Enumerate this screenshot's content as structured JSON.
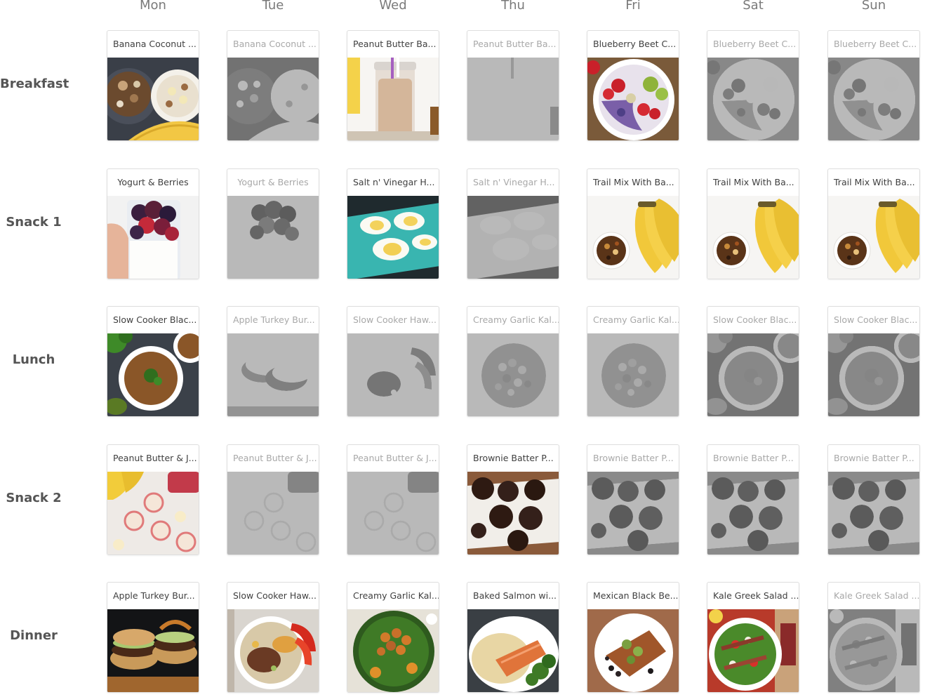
{
  "days": [
    "Mon",
    "Tue",
    "Wed",
    "Thu",
    "Fri",
    "Sat",
    "Sun"
  ],
  "meals": [
    {
      "label": "Breakfast",
      "items": [
        {
          "title": "Banana Coconut ...",
          "dim": false,
          "img": "oatmeal-bowl"
        },
        {
          "title": "Banana Coconut ...",
          "dim": true,
          "img": "oatmeal-bowl"
        },
        {
          "title": "Peanut Butter Ba...",
          "dim": false,
          "img": "smoothie-jar"
        },
        {
          "title": "Peanut Butter Ba...",
          "dim": true,
          "img": "smoothie-jar"
        },
        {
          "title": "Blueberry Beet C...",
          "dim": false,
          "img": "fruit-bowl"
        },
        {
          "title": "Blueberry Beet C...",
          "dim": true,
          "img": "fruit-bowl"
        },
        {
          "title": "Blueberry Beet C...",
          "dim": true,
          "img": "fruit-bowl"
        }
      ]
    },
    {
      "label": "Snack 1",
      "items": [
        {
          "title": "Yogurt & Berries",
          "dim": false,
          "img": "yogurt-cup"
        },
        {
          "title": "Yogurt & Berries",
          "dim": true,
          "img": "yogurt-cup"
        },
        {
          "title": "Salt n' Vinegar H...",
          "dim": false,
          "img": "eggs-plate"
        },
        {
          "title": "Salt n' Vinegar H...",
          "dim": true,
          "img": "eggs-plate"
        },
        {
          "title": "Trail Mix With Ba...",
          "dim": false,
          "img": "banana-trailmix"
        },
        {
          "title": "Trail Mix With Ba...",
          "dim": false,
          "img": "banana-trailmix"
        },
        {
          "title": "Trail Mix With Ba...",
          "dim": false,
          "img": "banana-trailmix"
        }
      ]
    },
    {
      "label": "Lunch",
      "items": [
        {
          "title": "Slow Cooker Blac...",
          "dim": false,
          "img": "soup-bowl"
        },
        {
          "title": "Apple Turkey Bur...",
          "dim": true,
          "img": "burger-plate"
        },
        {
          "title": "Slow Cooker Haw...",
          "dim": true,
          "img": "stew-plate"
        },
        {
          "title": "Creamy Garlic Kal...",
          "dim": true,
          "img": "grain-bowl"
        },
        {
          "title": "Creamy Garlic Kal...",
          "dim": true,
          "img": "grain-bowl"
        },
        {
          "title": "Slow Cooker Blac...",
          "dim": true,
          "img": "soup-bowl"
        },
        {
          "title": "Slow Cooker Blac...",
          "dim": true,
          "img": "soup-bowl"
        }
      ]
    },
    {
      "label": "Snack 2",
      "items": [
        {
          "title": "Peanut Butter & J...",
          "dim": false,
          "img": "pbj-rolls"
        },
        {
          "title": "Peanut Butter & J...",
          "dim": true,
          "img": "pbj-rolls"
        },
        {
          "title": "Peanut Butter & J...",
          "dim": true,
          "img": "pbj-rolls"
        },
        {
          "title": "Brownie Batter P...",
          "dim": false,
          "img": "brownie-bites"
        },
        {
          "title": "Brownie Batter P...",
          "dim": true,
          "img": "brownie-bites"
        },
        {
          "title": "Brownie Batter P...",
          "dim": true,
          "img": "brownie-bites"
        },
        {
          "title": "Brownie Batter P...",
          "dim": true,
          "img": "brownie-bites"
        }
      ]
    },
    {
      "label": "Dinner",
      "items": [
        {
          "title": "Apple Turkey Bur...",
          "dim": false,
          "img": "burger-dark"
        },
        {
          "title": "Slow Cooker Haw...",
          "dim": false,
          "img": "stew-plate"
        },
        {
          "title": "Creamy Garlic Kal...",
          "dim": false,
          "img": "kale-chickpea"
        },
        {
          "title": "Baked Salmon wi...",
          "dim": false,
          "img": "salmon-plate"
        },
        {
          "title": "Mexican Black Be...",
          "dim": false,
          "img": "fish-beans"
        },
        {
          "title": "Kale Greek Salad ...",
          "dim": false,
          "img": "greek-salad"
        },
        {
          "title": "Kale Greek Salad ...",
          "dim": true,
          "img": "greek-salad"
        }
      ]
    }
  ]
}
